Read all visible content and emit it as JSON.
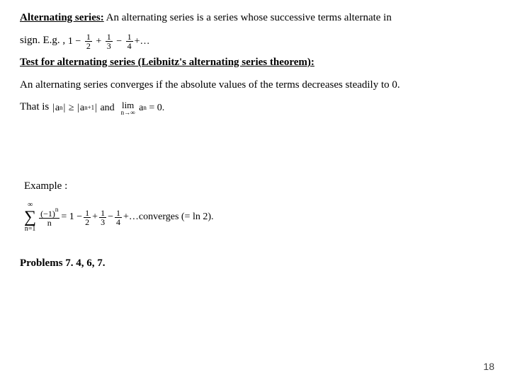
{
  "def": {
    "heading": "Alternating series:",
    "text1": " An alternating series is a series whose successive terms alternate in",
    "text2": "sign. E.g. , "
  },
  "series1": {
    "lead": "1",
    "t1n": "1",
    "t1d": "2",
    "t2n": "1",
    "t2d": "3",
    "t3n": "1",
    "t3d": "4",
    "dots": "+…"
  },
  "test": {
    "heading": "Test for alternating series (Leibnitz's alternating series theorem):",
    "line": "An alternating series converges if the absolute values of the terms decreases steadily to 0.",
    "thatis": "That is "
  },
  "cond": {
    "lhs_open": "|",
    "a": "a",
    "n": "n",
    "close": "|",
    "ge": " ≥ ",
    "a2": "a",
    "n1": "n+1",
    "and": " and  ",
    "lim": "lim",
    "limsub": "n→∞",
    "expr": " a",
    "exprsub": "n",
    "eq": " = 0."
  },
  "example": {
    "label": "Example :",
    "sum_top": "∞",
    "sum_bot": "n=1",
    "fr_top": "(−1)",
    "fr_top_sup": "n",
    "fr_bot": "n",
    "eq": " = 1 − ",
    "f1n": "1",
    "f1d": "2",
    "plus": " + ",
    "f2n": "1",
    "f2d": "3",
    "minus": " − ",
    "f3n": "1",
    "f3d": "4",
    "dots": " +…",
    "tail": "   converges (= ln 2)."
  },
  "problems": "Problems 7. 4, 6, 7.",
  "page": "18"
}
